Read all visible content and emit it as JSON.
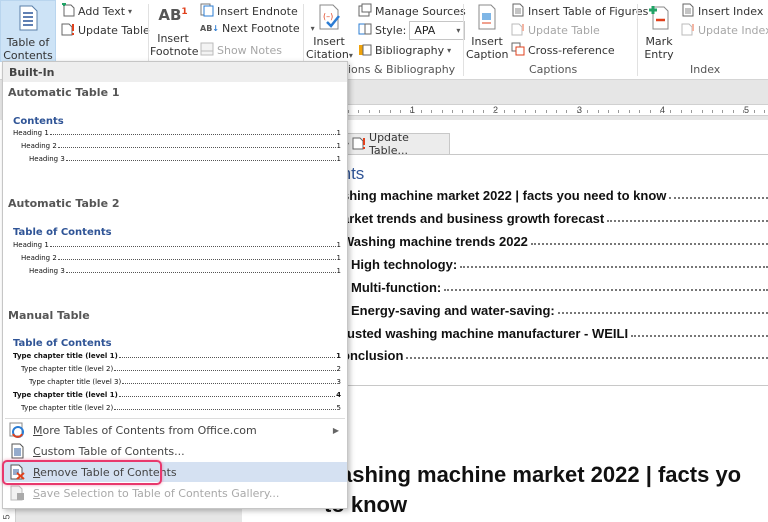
{
  "ribbon": {
    "toc_button": {
      "line1": "Table of",
      "line2": "Contents"
    },
    "add_text": "Add Text",
    "update_table": "Update Table",
    "insert_footnote": {
      "line1": "Insert",
      "line2": "Footnote"
    },
    "insert_endnote": "Insert Endnote",
    "next_footnote": "Next Footnote",
    "show_notes": "Show Notes",
    "insert_citation": {
      "line1": "Insert",
      "line2": "Citation"
    },
    "manage_sources": "Manage Sources",
    "style_label": "Style:",
    "style_value": "APA",
    "bibliography": "Bibliography",
    "citations_group": "ions & Bibliography",
    "insert_caption": {
      "line1": "Insert",
      "line2": "Caption"
    },
    "insert_table_of_figures": "Insert Table of Figures",
    "update_table_captions": "Update Table",
    "cross_reference": "Cross-reference",
    "captions_group": "Captions",
    "mark_entry": {
      "line1": "Mark",
      "line2": "Entry"
    },
    "insert_index": "Insert Index",
    "update_index": "Update Index",
    "index_group": "Index"
  },
  "ruler": {
    "numbers": [
      "1",
      "2",
      "3",
      "4",
      "5"
    ]
  },
  "vruler": {
    "numbers": [
      "5"
    ]
  },
  "menu": {
    "header": "Built-In",
    "galleries": [
      {
        "title": "Automatic Table 1",
        "subtitle": "Contents",
        "lines": [
          {
            "text": "Heading 1",
            "page": "1"
          },
          {
            "text": "Heading 2",
            "page": "1"
          },
          {
            "text": "Heading 3",
            "page": "1"
          }
        ]
      },
      {
        "title": "Automatic Table 2",
        "subtitle": "Table of Contents",
        "lines": [
          {
            "text": "Heading 1",
            "page": "1"
          },
          {
            "text": "Heading 2",
            "page": "1"
          },
          {
            "text": "Heading 3",
            "page": "1"
          }
        ]
      },
      {
        "title": "Manual Table",
        "subtitle": "Table of Contents",
        "lines": [
          {
            "text": "Type chapter title (level 1)",
            "page": "1"
          },
          {
            "text": "Type chapter title (level 2)",
            "page": "2"
          },
          {
            "text": "Type chapter title (level 3)",
            "page": "3"
          },
          {
            "text": "Type chapter title (level 1)",
            "page": "4"
          },
          {
            "text": "Type chapter title (level 2)",
            "page": "5"
          }
        ]
      }
    ],
    "items": [
      {
        "label_u": "M",
        "label_rest": "ore Tables of Contents from Office.com"
      },
      {
        "label_u": "C",
        "label_rest": "ustom Table of Contents..."
      },
      {
        "label_u": "R",
        "label_rest": "emove Table of Contents"
      },
      {
        "label_u": "S",
        "label_rest": "ave Selection to Table of Contents Gallery..."
      }
    ]
  },
  "document": {
    "update_table_tab": "Update Table...",
    "toc_title": "ntents",
    "toc_entries": [
      "shing machine market 2022 | facts you need to know",
      "arket trends and business growth forecast",
      "Washing machine trends 2022",
      "High technology:",
      "Multi-function:",
      "Energy-saving and water-saving:",
      "rusted washing machine manufacturer - WEILI",
      "onclusion"
    ],
    "heading_line1": "ashing machine market 2022 | facts yo",
    "heading_line2": "to know"
  }
}
